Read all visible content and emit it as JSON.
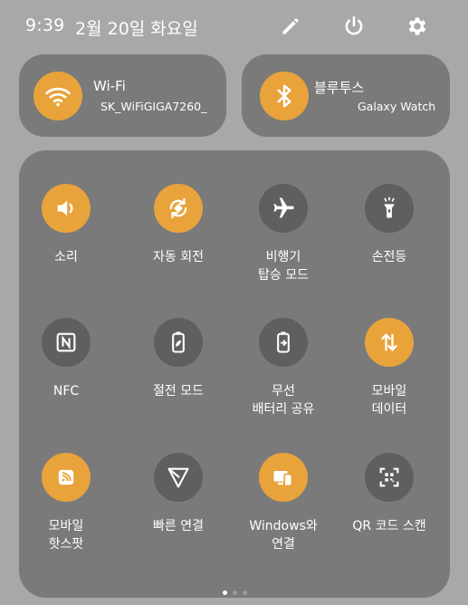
{
  "status": {
    "time": "9:39",
    "date": "2월 20일 화요일",
    "icons": [
      "pencil-icon",
      "power-icon",
      "gear-icon"
    ]
  },
  "wifi": {
    "title": "Wi-Fi",
    "subtitle": "SK_WiFiGIGA7260_",
    "icon": "wifi-icon",
    "on": true
  },
  "bluetooth": {
    "title": "블루투스",
    "subtitle": "Galaxy Watch",
    "icon": "bluetooth-icon",
    "on": true
  },
  "tiles": [
    {
      "label": "소리",
      "icon": "speaker-icon",
      "on": true
    },
    {
      "label": "자동 회전",
      "icon": "rotate-icon",
      "on": true
    },
    {
      "label": "비행기\n탑승 모드",
      "icon": "airplane-icon",
      "on": false
    },
    {
      "label": "손전등",
      "icon": "flashlight-icon",
      "on": false
    },
    {
      "label": "NFC",
      "icon": "nfc-icon",
      "on": false
    },
    {
      "label": "절전 모드",
      "icon": "battery-leaf-icon",
      "on": false
    },
    {
      "label": "무선\n배터리 공유",
      "icon": "battery-share-icon",
      "on": false
    },
    {
      "label": "모바일\n데이터",
      "icon": "mobile-data-icon",
      "on": true
    },
    {
      "label": "모바일\n핫스팟",
      "icon": "hotspot-icon",
      "on": true
    },
    {
      "label": "빠른 연결",
      "icon": "quick-share-icon",
      "on": false
    },
    {
      "label": "Windows와\n연결",
      "icon": "link-to-windows-icon",
      "on": true
    },
    {
      "label": "QR 코드 스캔",
      "icon": "qr-scan-icon",
      "on": false
    }
  ],
  "pager": {
    "pages": 3,
    "current": 1
  },
  "colors": {
    "accent": "#e9a33b",
    "tile_off": "#5f5f5f",
    "panel": "#7a7a7a",
    "background": "#a8a8a8"
  }
}
